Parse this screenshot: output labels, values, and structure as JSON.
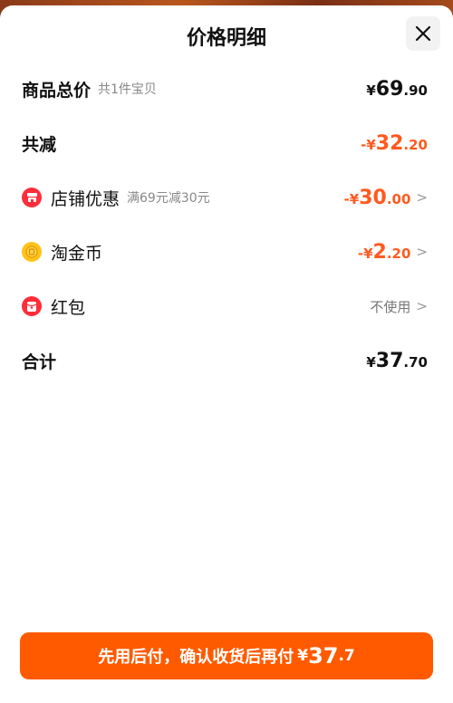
{
  "sheet": {
    "title": "价格明细"
  },
  "rows": {
    "total": {
      "label": "商品总价",
      "sub": "共1件宝贝",
      "sign": "¥",
      "int": "69",
      "dec": ".90"
    },
    "discount": {
      "label": "共减",
      "sign": "-¥",
      "int": "32",
      "dec": ".20"
    },
    "shop": {
      "label": "店铺优惠",
      "sub": "满69元减30元",
      "sign": "-¥",
      "int": "30",
      "dec": ".00",
      "icon": "shop-icon"
    },
    "coins": {
      "label": "淘金币",
      "sign": "-¥",
      "int": "2",
      "dec": ".20",
      "icon": "gold-coin-icon"
    },
    "redpacket": {
      "label": "红包",
      "value": "不使用",
      "icon": "red-packet-icon"
    },
    "sum": {
      "label": "合计",
      "sign": "¥",
      "int": "37",
      "dec": ".70"
    }
  },
  "pay_button": {
    "text": "先用后付，确认收货后再付",
    "sign": "¥",
    "int": "37",
    "dec": ".7"
  },
  "colors": {
    "accent": "#ff5a00",
    "discount": "#ff5a1f",
    "text": "#111111",
    "muted": "#888888"
  }
}
